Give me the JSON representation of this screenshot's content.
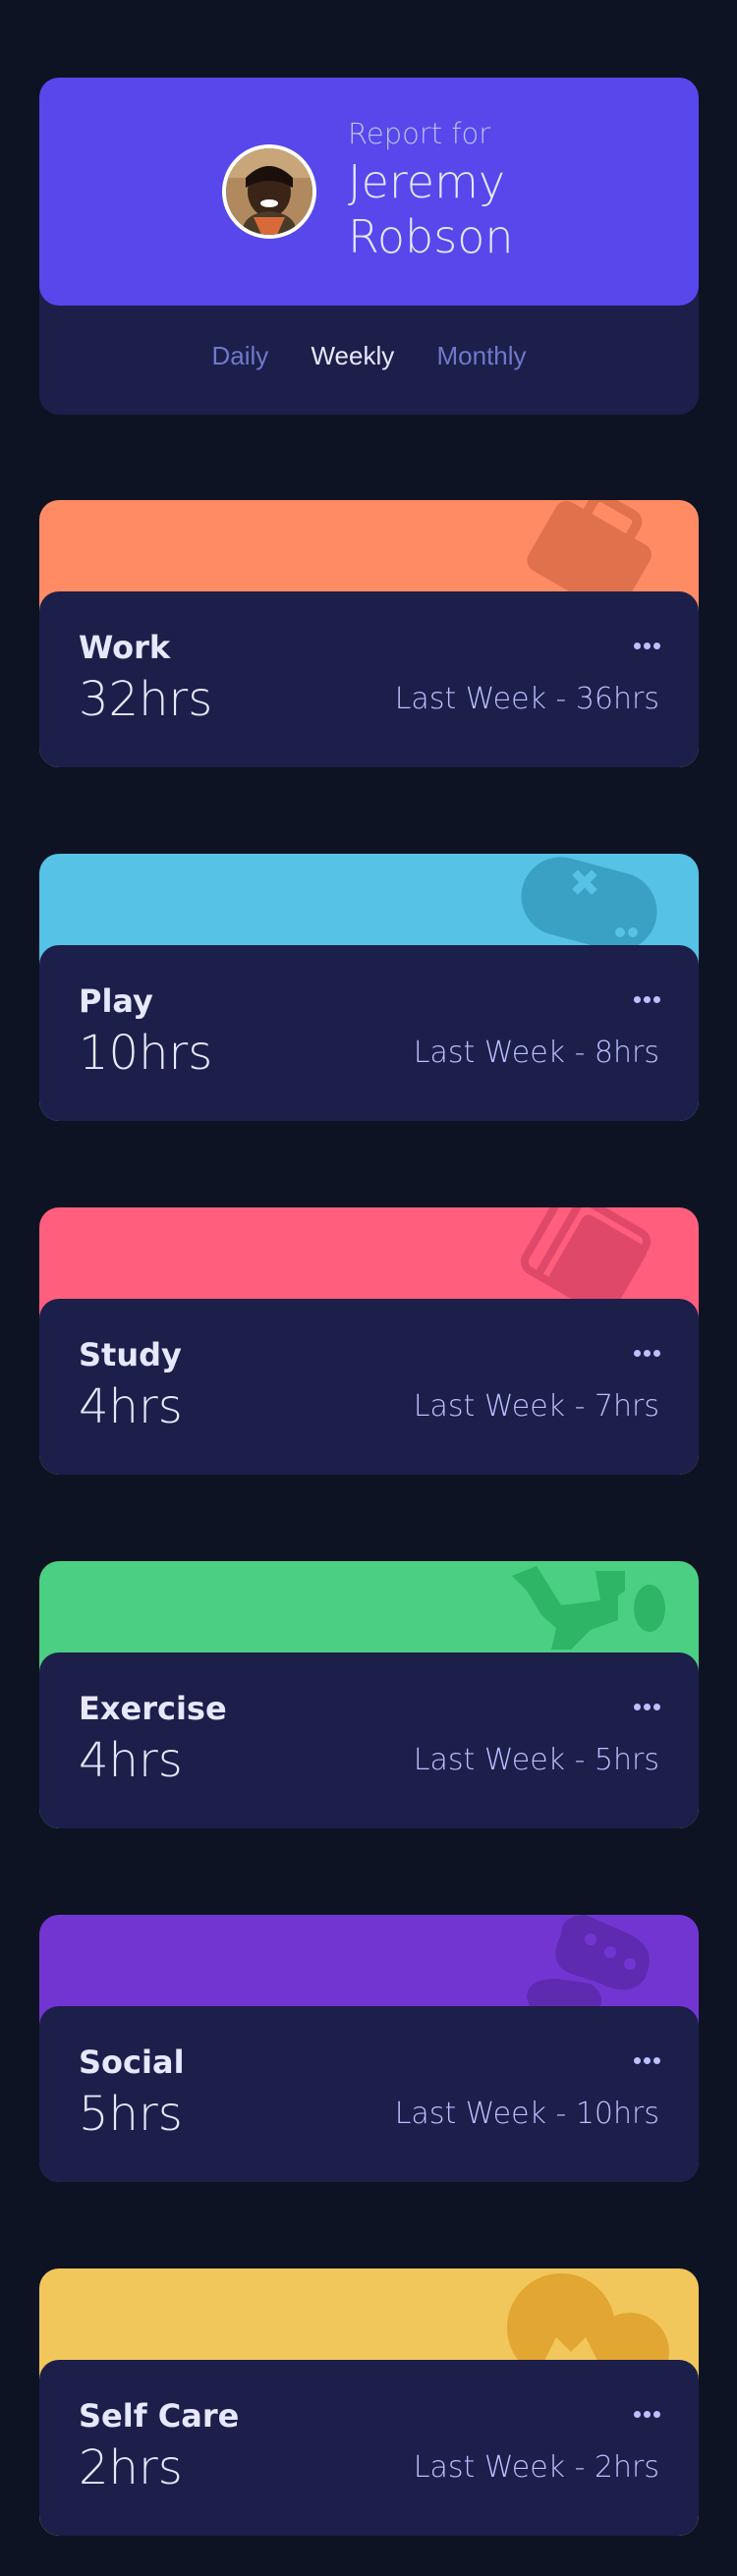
{
  "profile": {
    "report_for": "Report for",
    "name": "Jeremy Robson",
    "periods": [
      "Daily",
      "Weekly",
      "Monthly"
    ],
    "active_period": "Weekly"
  },
  "activities": [
    {
      "title": "Work",
      "hours": "32hrs",
      "previous": "Last Week - 36hrs",
      "color": "#ff8b64",
      "icon": "briefcase-icon"
    },
    {
      "title": "Play",
      "hours": "10hrs",
      "previous": "Last Week - 8hrs",
      "color": "#55c2e6",
      "icon": "gamepad-icon"
    },
    {
      "title": "Study",
      "hours": "4hrs",
      "previous": "Last Week - 7hrs",
      "color": "#ff5e7d",
      "icon": "book-icon"
    },
    {
      "title": "Exercise",
      "hours": "4hrs",
      "previous": "Last Week - 5hrs",
      "color": "#4bcf82",
      "icon": "running-person-icon"
    },
    {
      "title": "Social",
      "hours": "5hrs",
      "previous": "Last Week - 10hrs",
      "color": "#7335d2",
      "icon": "speech-bubble-icon"
    },
    {
      "title": "Self Care",
      "hours": "2hrs",
      "previous": "Last Week - 2hrs",
      "color": "#f1c75b",
      "icon": "heart-icon"
    }
  ]
}
